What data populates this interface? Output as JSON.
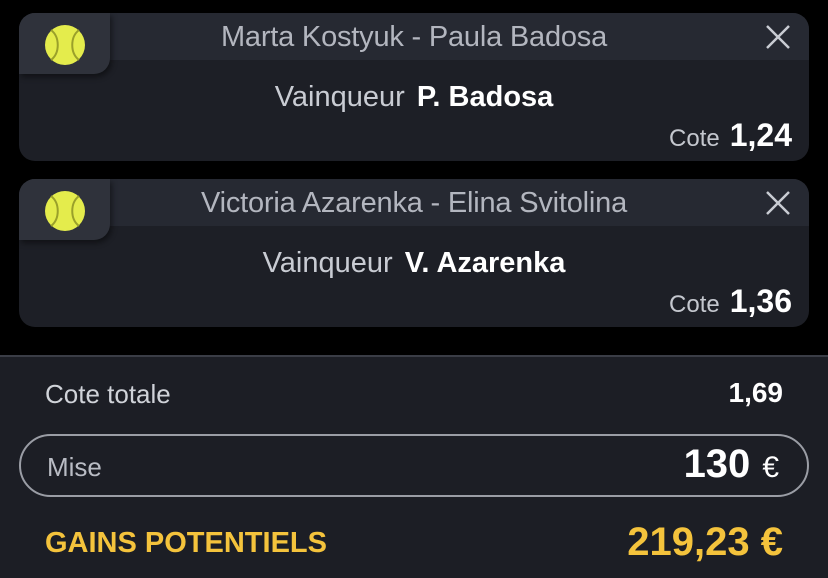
{
  "colors": {
    "accent": "#f4c33c",
    "card_bg": "#1d1f26",
    "card_header_bg": "#262932",
    "ball": "#e4ec4c"
  },
  "bets": [
    {
      "sport_icon": "tennis-ball-icon",
      "match": "Marta Kostyuk - Paula Badosa",
      "market_label": "Vainqueur",
      "pick": "P. Badosa",
      "cote_label": "Cote",
      "cote": "1,24",
      "close_icon": "close-icon"
    },
    {
      "sport_icon": "tennis-ball-icon",
      "match": "Victoria Azarenka - Elina Svitolina",
      "market_label": "Vainqueur",
      "pick": "V. Azarenka",
      "cote_label": "Cote",
      "cote": "1,36",
      "close_icon": "close-icon"
    }
  ],
  "summary": {
    "total_label": "Cote totale",
    "total_value": "1,69",
    "stake_label": "Mise",
    "stake_value": "130",
    "stake_currency": "€",
    "gains_label": "GAINS POTENTIELS",
    "gains_value": "219,23 €"
  }
}
